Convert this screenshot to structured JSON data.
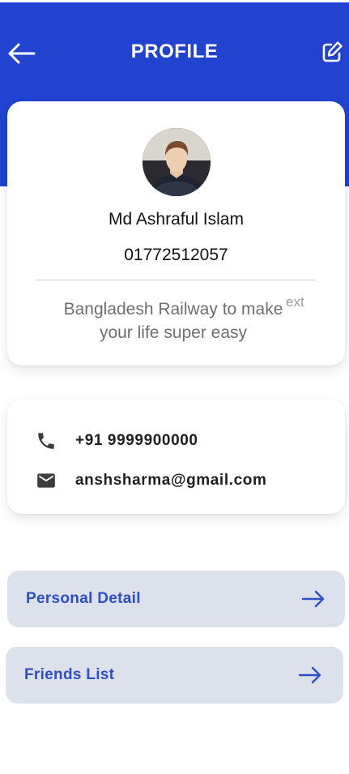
{
  "header": {
    "title": "PROFILE"
  },
  "profile": {
    "name": "Md Ashraful Islam",
    "phone": "01772512057",
    "overflow_text": "ext",
    "description": "Bangladesh Railway to make your life super easy"
  },
  "contact": {
    "phone": "+91 9999900000",
    "email": "anshsharma@gmail.com"
  },
  "menu": {
    "personal_detail": "Personal Detail",
    "friends_list": "Friends List"
  },
  "colors": {
    "header_bg": "#2243cf",
    "menu_bg": "#dde1ec",
    "menu_text": "#2d4ec4"
  }
}
